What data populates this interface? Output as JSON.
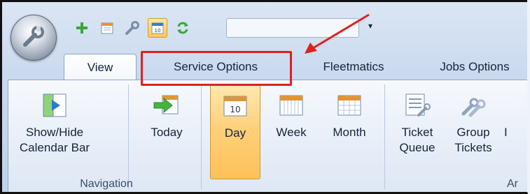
{
  "quick_access": {
    "icons": [
      "add-icon",
      "calendar-list-icon",
      "wrench-icon",
      "day-calendar-icon",
      "refresh-icon"
    ],
    "active_icon": "day-calendar-icon",
    "search_value": ""
  },
  "tabs": [
    {
      "label": "View",
      "active": true
    },
    {
      "label": "Service Options",
      "highlighted": true
    },
    {
      "label": "Fleetmatics"
    },
    {
      "label": "Jobs Options"
    }
  ],
  "ribbon": {
    "buttons": [
      {
        "label1": "Show/Hide",
        "label2": "Calendar Bar",
        "icon": "calendar-bar-icon"
      },
      {
        "label1": "Today",
        "label2": "",
        "icon": "today-arrow-icon"
      },
      {
        "label1": "Day",
        "label2": "",
        "icon": "day-view-icon",
        "selected": true
      },
      {
        "label1": "Week",
        "label2": "",
        "icon": "week-view-icon"
      },
      {
        "label1": "Month",
        "label2": "",
        "icon": "month-view-icon"
      },
      {
        "label1": "Ticket",
        "label2": "Queue",
        "icon": "ticket-queue-icon"
      },
      {
        "label1": "Group",
        "label2": "Tickets",
        "icon": "group-tickets-icon"
      },
      {
        "label1": "I",
        "label2": "",
        "icon": "partial-icon"
      }
    ],
    "groups": [
      {
        "label": "Navigation"
      },
      {
        "label": "Ar"
      }
    ]
  },
  "annotation": {
    "color": "#e02020"
  }
}
